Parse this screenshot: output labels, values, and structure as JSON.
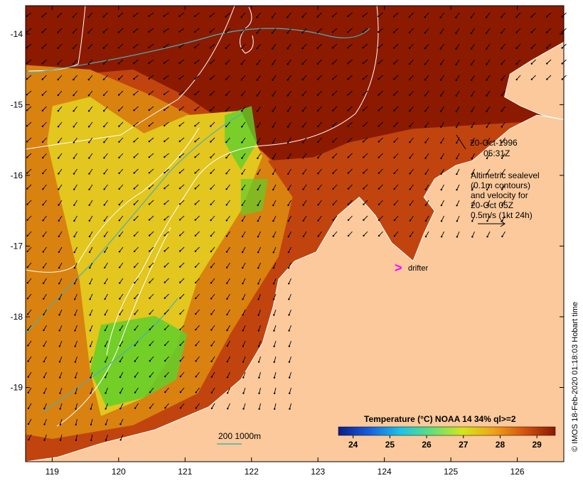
{
  "map": {
    "x_axis": {
      "min": 118.6,
      "max": 126.7,
      "ticks": [
        119,
        120,
        121,
        122,
        123,
        124,
        125,
        126
      ]
    },
    "y_axis": {
      "min": -20.05,
      "max": -13.6,
      "ticks": [
        -14,
        -15,
        -16,
        -17,
        -18,
        -19
      ]
    },
    "colors": {
      "sea_warm": "#8b1a00",
      "sea_mid": "#c1440e",
      "sea_orange": "#d9820f",
      "sea_yellow": "#e3c61e",
      "sea_green": "#5fcf2a",
      "land": "#fbc99b",
      "coast": "#ffffff",
      "contour": "#ffffff",
      "isobath": "#4ab0b8",
      "drifter": "#ff00ff"
    }
  },
  "annotations": {
    "date_line1": "20-Oct-1996",
    "date_line2": "05:31Z",
    "alt_line1": "Altimetric sealevel",
    "alt_line2": "(0.1m contours)",
    "alt_line3": "and velocity for",
    "alt_line4": "20-Oct 05Z",
    "alt_line5": "0.5m/s (1kt 24h)",
    "drifter_symbol": ">",
    "drifter_label": "drifter",
    "isobath_label": "200  1000m"
  },
  "colorbar": {
    "title": "Temperature (°C) NOAA 14 34% ql>=2",
    "ticks": [
      24,
      25,
      26,
      27,
      28,
      29
    ],
    "range": [
      23.6,
      29.5
    ],
    "stops": [
      "#0a1d8a",
      "#1560e0",
      "#17c5e8",
      "#5fe07a",
      "#d4e61a",
      "#f0a417",
      "#d6520e",
      "#8b1a00"
    ]
  },
  "credit": "© IMOS 18-Feb-2020 01:18:03 Hobart time"
}
